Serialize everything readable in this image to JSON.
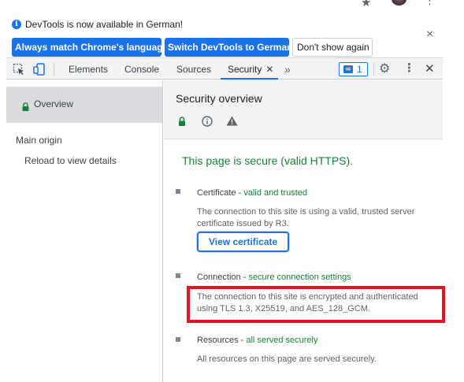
{
  "infobar": {
    "message": "DevTools is now available in German!",
    "primary_button_1": "Always match Chrome's language",
    "primary_button_2": "Switch DevTools to German",
    "secondary_button": "Don't show again",
    "close": "×"
  },
  "tabs": [
    {
      "label": "Elements"
    },
    {
      "label": "Console"
    },
    {
      "label": "Sources"
    },
    {
      "label": "Security"
    }
  ],
  "tab_close": "✕",
  "more_tabs": "»",
  "issues_badge": {
    "count": "1"
  },
  "toolbar": {
    "settings": "⚙",
    "more": "⋮",
    "close": "✕"
  },
  "sidebar": {
    "overview": "Overview",
    "main_origin": "Main origin",
    "reload": "Reload to view details"
  },
  "main": {
    "title": "Security overview",
    "secure_message": "This page is secure (valid HTTPS).",
    "items": [
      {
        "title": "Certificate",
        "status": "valid and trusted",
        "description": "The connection to this site is using a valid, trusted server certificate issued by R3."
      },
      {
        "title": "Connection",
        "status": "secure connection settings",
        "description": "The connection to this site is encrypted and authenticated using TLS 1.3, X25519, and AES_128_GCM."
      },
      {
        "title": "Resources",
        "status": "all served securely",
        "description": "All resources on this page are served securely."
      }
    ],
    "view_certificate": "View certificate"
  },
  "colors": {
    "accent": "#1a73e8",
    "secure_green": "#188038",
    "highlight_red": "#e81123"
  }
}
